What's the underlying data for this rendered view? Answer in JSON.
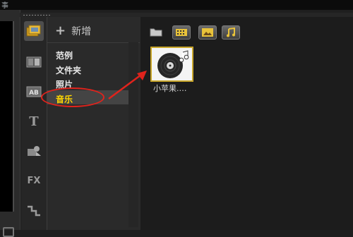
{
  "window": {
    "title_fragment": "事"
  },
  "category_sidebar": {
    "items": [
      "media-icon",
      "transition-icon",
      "title-icon",
      "text-icon",
      "graphic-icon",
      "fx-icon",
      "path-icon"
    ],
    "fx_label": "FX",
    "text_label": "T",
    "title_label": "AB"
  },
  "library": {
    "add_label": "新增",
    "folders": [
      "范例",
      "文件夹",
      "照片",
      "音乐"
    ],
    "selected_folder": "音乐"
  },
  "content": {
    "toolbar": [
      "folder-icon",
      "video-filter-icon",
      "image-filter-icon",
      "audio-filter-icon"
    ],
    "items": [
      {
        "label": "小苹果.…",
        "kind": "music-disc"
      }
    ]
  },
  "colors": {
    "annotation": "#e0231c",
    "selection_border": "#c8a62a",
    "audio_note": "#e8c23a"
  }
}
